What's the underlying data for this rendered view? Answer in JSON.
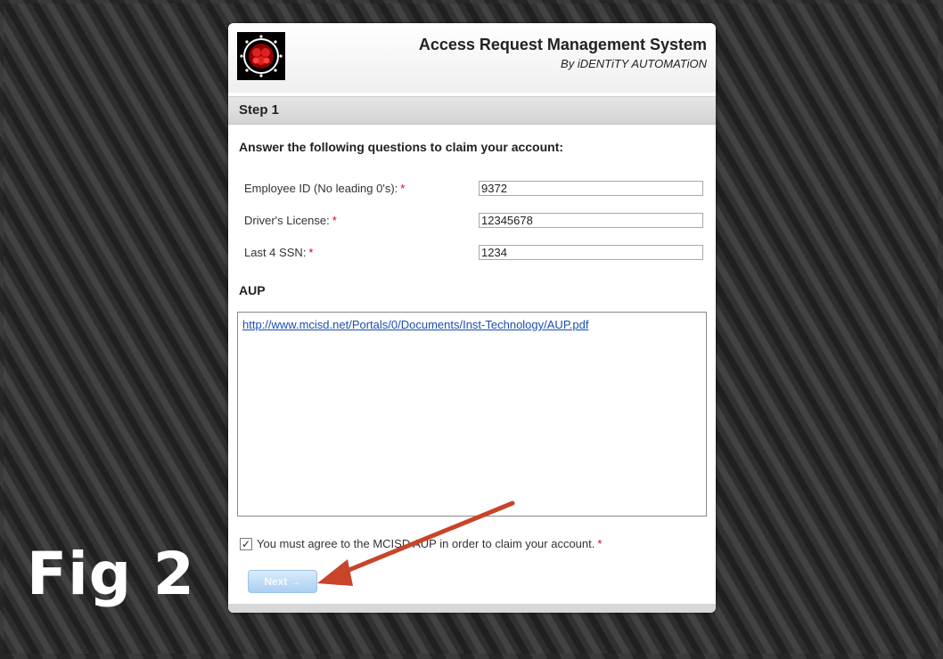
{
  "figure_label": "Fig 2",
  "header": {
    "title": "Access Request Management System",
    "subtitle": "By iDENTiTY AUTOMATiON"
  },
  "step": {
    "title": "Step 1"
  },
  "instructions": "Answer the following questions to claim your account:",
  "fields": [
    {
      "label": "Employee ID (No leading 0's):",
      "required_mark": "*",
      "value": "9372"
    },
    {
      "label": "Driver's License:",
      "required_mark": "*",
      "value": "12345678"
    },
    {
      "label": "Last 4 SSN:",
      "required_mark": "*",
      "value": "1234"
    }
  ],
  "aup": {
    "title": "AUP",
    "link_text": "http://www.mcisd.net/Portals/0/Documents/Inst-Technology/AUP.pdf"
  },
  "agree": {
    "checked": true,
    "check_glyph": "✓",
    "label": "You must agree to the MCISD AUP in order to claim your account.",
    "required_mark": "*"
  },
  "next_button": {
    "label": "Next →"
  },
  "colors": {
    "annotation_arrow": "#c8452a",
    "required_mark": "#d0021b",
    "link": "#1a4fb0"
  }
}
